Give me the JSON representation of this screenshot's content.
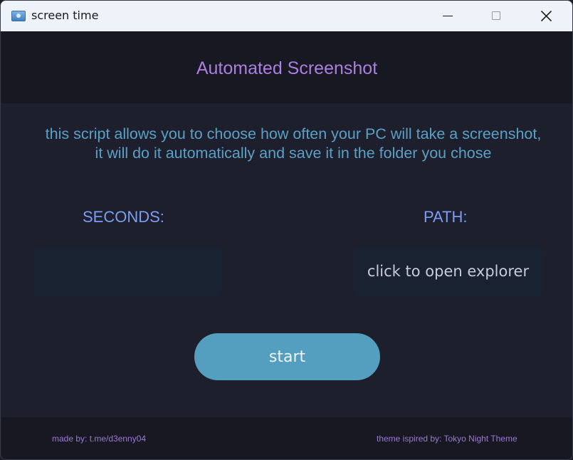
{
  "window": {
    "title": "screen time",
    "icon": "app-window-icon",
    "controls": [
      "minimize-icon",
      "maximize-icon",
      "close-icon"
    ]
  },
  "header": {
    "title": "Automated Screenshot"
  },
  "main": {
    "description": "this script allows you to choose how often your PC will take a screenshot, it will do it automatically and save it in the folder you chose",
    "seconds_label": "SECONDS:",
    "seconds_value": "",
    "path_label": "PATH:",
    "path_button_label": "click to open explorer",
    "start_label": "start"
  },
  "footer": {
    "left_text": "made by: t.me/d3enny04",
    "right_text": "theme ispired by: Tokyo Night Theme"
  },
  "colors": {
    "title_accent": "#ab7fdf",
    "description_text": "#5aa0c6",
    "label_text": "#7b9df5",
    "start_button": "#549fbf",
    "background": "#1e1f2c"
  }
}
